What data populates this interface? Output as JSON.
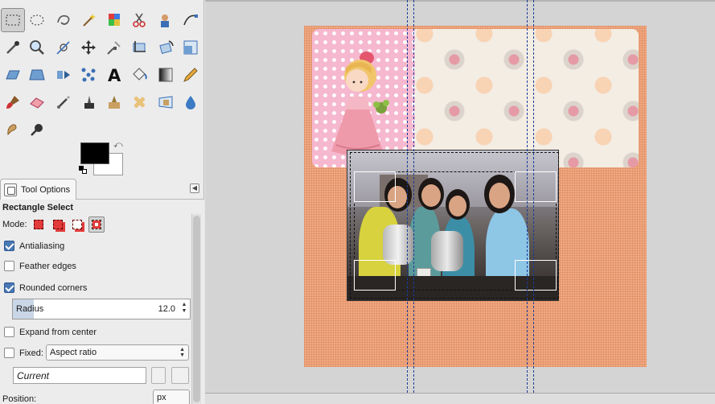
{
  "tools": [
    {
      "name": "rect-select-tool-icon",
      "active": true
    },
    {
      "name": "ellipse-select-tool-icon"
    },
    {
      "name": "free-select-tool-icon"
    },
    {
      "name": "fuzzy-select-tool-icon"
    },
    {
      "name": "select-by-color-tool-icon"
    },
    {
      "name": "scissors-select-tool-icon"
    },
    {
      "name": "foreground-select-tool-icon"
    },
    {
      "name": "paths-tool-icon"
    },
    {
      "name": "color-picker-tool-icon"
    },
    {
      "name": "zoom-tool-icon"
    },
    {
      "name": "measure-tool-icon"
    },
    {
      "name": "move-tool-icon"
    },
    {
      "name": "align-tool-icon"
    },
    {
      "name": "crop-tool-icon"
    },
    {
      "name": "rotate-tool-icon"
    },
    {
      "name": "scale-tool-icon"
    },
    {
      "name": "shear-tool-icon"
    },
    {
      "name": "perspective-tool-icon"
    },
    {
      "name": "flip-tool-icon"
    },
    {
      "name": "cage-transform-tool-icon"
    },
    {
      "name": "text-tool-icon",
      "glyph": "A"
    },
    {
      "name": "bucket-fill-tool-icon"
    },
    {
      "name": "blend-tool-icon"
    },
    {
      "name": "pencil-tool-icon"
    },
    {
      "name": "paintbrush-tool-icon"
    },
    {
      "name": "eraser-tool-icon"
    },
    {
      "name": "airbrush-tool-icon"
    },
    {
      "name": "ink-tool-icon"
    },
    {
      "name": "clone-tool-icon"
    },
    {
      "name": "heal-tool-icon"
    },
    {
      "name": "perspective-clone-tool-icon"
    },
    {
      "name": "blur-sharpen-tool-icon"
    },
    {
      "name": "smudge-tool-icon"
    },
    {
      "name": "dodge-burn-tool-icon"
    }
  ],
  "colors": {
    "foreground": "#000000",
    "background": "#ffffff",
    "checkbox_accent": "#4a78b5"
  },
  "panel": {
    "tab_label": "Tool Options",
    "title": "Rectangle Select",
    "mode_label": "Mode:",
    "options": {
      "antialiasing": {
        "label": "Antialiasing",
        "checked": true
      },
      "feather_edges": {
        "label": "Feather edges",
        "checked": false
      },
      "rounded_corners": {
        "label": "Rounded corners",
        "checked": true
      },
      "expand_from_center": {
        "label": "Expand from center",
        "checked": false
      },
      "fixed": {
        "label": "Fixed:",
        "checked": false
      }
    },
    "radius": {
      "label": "Radius",
      "value": "12.0",
      "fraction": 0.12
    },
    "fixed_select": "Aspect ratio",
    "current_value": "Current",
    "position_label": "Position:",
    "unit": "px"
  }
}
